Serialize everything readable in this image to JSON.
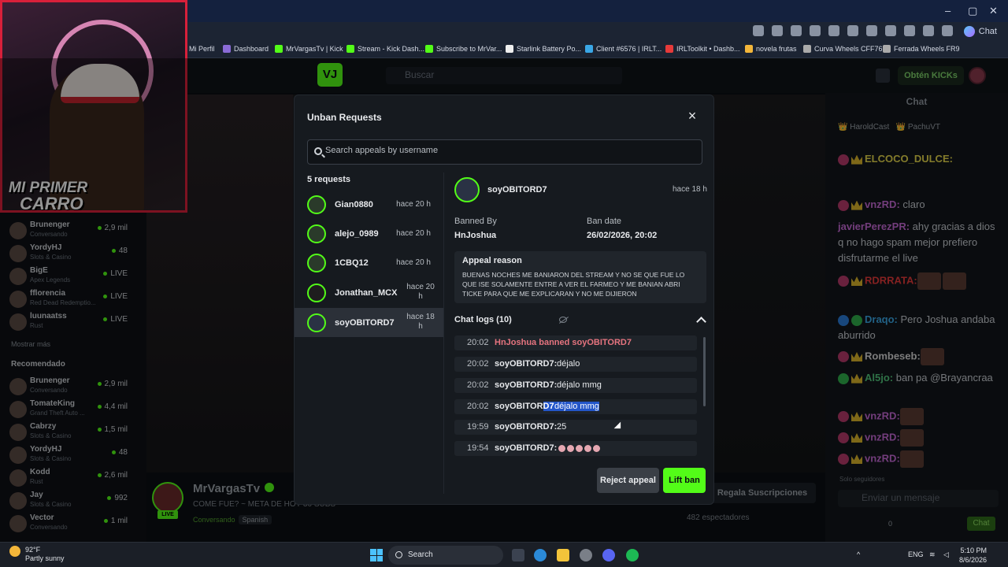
{
  "browser": {
    "assistant_label": "Chat",
    "bookmarks": [
      "Mi Perfil",
      "Dashboard",
      "MrVargasTv | Kick",
      "Stream - Kick Dash...",
      "Subscribe to MrVar...",
      "Starlink Battery Po...",
      "Client #6576 | IRLT...",
      "IRLToolkit • Dashb...",
      "novela frutas",
      "Curva Wheels CFF76",
      "Ferrada Wheels FR9"
    ]
  },
  "site": {
    "search_placeholder": "Buscar",
    "kicks_label": "Obtén KICKs"
  },
  "webcam": {
    "overlay_line1": "MI PRIMER",
    "overlay_line2": "CARRO"
  },
  "sidebar": {
    "following": [
      {
        "name": "Brunenger",
        "game": "Conversando",
        "viewers": "2,9 mil"
      },
      {
        "name": "YordyHJ",
        "game": "Slots & Casino",
        "viewers": "48"
      },
      {
        "name": "BigE",
        "game": "Apex Legends",
        "viewers": "LIVE"
      },
      {
        "name": "fflorencia",
        "game": "Red Dead Redemptio...",
        "viewers": "LIVE"
      },
      {
        "name": "luunaatss",
        "game": "Rust",
        "viewers": "LIVE"
      }
    ],
    "show_more": "Mostrar más",
    "recommended_heading": "Recomendado",
    "recommended": [
      {
        "name": "Brunenger",
        "game": "Conversando",
        "viewers": "2,9 mil"
      },
      {
        "name": "TomateKing",
        "game": "Grand Theft Auto ...",
        "viewers": "4,4 mil"
      },
      {
        "name": "Cabrzy",
        "game": "Slots & Casino",
        "viewers": "1,5 mil"
      },
      {
        "name": "YordyHJ",
        "game": "Slots & Casino",
        "viewers": "48"
      },
      {
        "name": "Kodd",
        "game": "Rust",
        "viewers": "2,6 mil"
      },
      {
        "name": "Jay",
        "game": "Slots & Casino",
        "viewers": "992"
      },
      {
        "name": "Vector",
        "game": "Conversando",
        "viewers": "1 mil"
      }
    ]
  },
  "stream": {
    "streamer": "MrVargasTv",
    "live": "LIVE",
    "title": "COME FUE? ~ META DE HOY 30 SUBS",
    "category": "Conversando",
    "language": "Spanish",
    "viewers": "482 espectadores",
    "gift_subs": "Regala Suscripciones"
  },
  "chat": {
    "header": "Chat",
    "pinned": [
      "HaroldCast",
      "PachuVT"
    ],
    "messages": [
      {
        "user": "ELCOCO_DULCE:",
        "text": "",
        "color": "#e4d64b"
      },
      {
        "user": "vnzRD:",
        "text": " claro",
        "color": "#c66ad6"
      },
      {
        "user": "javierPerezPR:",
        "text": " ahy gracias a dios q no hago spam mejor prefiero disfrutarme el live",
        "color": "#c66ad6"
      },
      {
        "user": "RDRRATA:",
        "text": "",
        "color": "#e63a3a"
      },
      {
        "user": "Draqo:",
        "text": " Pero Joshua andaba aburrido",
        "color": "#3aa7e6"
      },
      {
        "user": "Rombeseb:",
        "text": "",
        "color": "#d8d8d8"
      },
      {
        "user": "Al5jo:",
        "text": " ban pa @Brayancraa",
        "color": "#52c47a"
      },
      {
        "user": "vnzRD:",
        "text": "",
        "color": "#c66ad6"
      },
      {
        "user": "vnzRD:",
        "text": "",
        "color": "#c66ad6"
      },
      {
        "user": "vnzRD:",
        "text": "",
        "color": "#c66ad6"
      }
    ],
    "followers_only": "Solo seguidores",
    "input_placeholder": "Enviar un mensaje",
    "points": "0",
    "send_label": "Chat"
  },
  "modal": {
    "title": "Unban Requests",
    "search_placeholder": "Search appeals by username",
    "requests_count": "5 requests",
    "requests": [
      {
        "name": "Gian0880",
        "time": "hace 20 h"
      },
      {
        "name": "alejo_0989",
        "time": "hace 20 h"
      },
      {
        "name": "1CBQ12",
        "time": "hace 20 h"
      },
      {
        "name": "Jonathan_MCX",
        "time": "hace 20 h"
      },
      {
        "name": "soyOBITORD7",
        "time": "hace 18 h"
      }
    ],
    "selected": {
      "name": "soyOBITORD7",
      "time": "hace 18 h",
      "banned_by_label": "Banned By",
      "banned_by": "HnJoshua",
      "ban_date_label": "Ban date",
      "ban_date": "26/02/2026, 20:02",
      "appeal_reason_label": "Appeal reason",
      "appeal_reason": "BUENAS NOCHES ME BANIARON DEL STREAM Y NO SE QUE FUE LO QUE ISE SOLAMENTE ENTRE A VER EL FARMEO Y ME BANIAN ABRI TICKE PARA QUE ME EXPLICARAN Y NO ME DIJIERON"
    },
    "chat_logs_label": "Chat logs (10)",
    "logs": [
      {
        "time": "20:02",
        "user": "HnJoshua banned soyOBITORD7",
        "msg": "",
        "type": "ban"
      },
      {
        "time": "20:02",
        "user": "soyOBITORD7:",
        "msg": "déjalo",
        "type": "msg"
      },
      {
        "time": "20:02",
        "user": "soyOBITORD7:",
        "msg": "déjalo mmg",
        "type": "msg"
      },
      {
        "time": "20:02",
        "user_plain": "soyOBITOR",
        "user_hl": "D7:",
        "msg": "déjalo mmg",
        "type": "highlight"
      },
      {
        "time": "19:59",
        "user": "soyOBITORD7:",
        "msg": "25",
        "type": "msg"
      },
      {
        "time": "19:54",
        "user": "soyOBITORD7:",
        "msg": "",
        "type": "emotes"
      }
    ],
    "reject_label": "Reject appeal",
    "lift_label": "Lift ban"
  },
  "taskbar": {
    "temperature": "92°F",
    "weather": "Partly sunny",
    "search": "Search",
    "lang": "ENG",
    "time": "5:10 PM",
    "date": "8/6/2026"
  }
}
